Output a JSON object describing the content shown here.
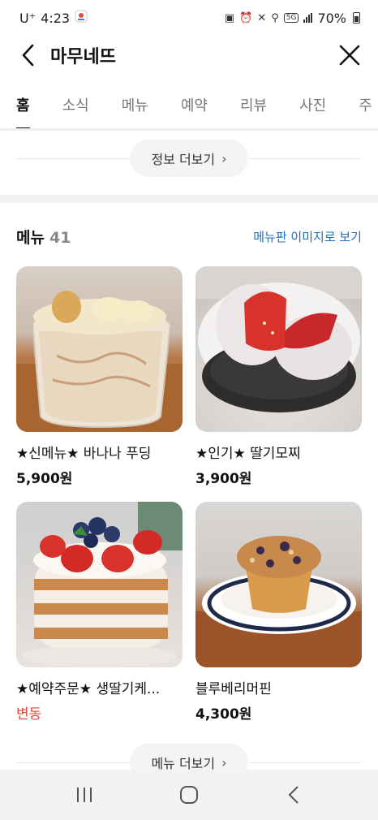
{
  "status_bar": {
    "carrier": "U⁺",
    "time": "4:23",
    "network": "5G",
    "battery_percent": "70%"
  },
  "header": {
    "title": "마무네뜨",
    "back_icon": "chevron-left-icon",
    "close_icon": "close-icon"
  },
  "tabs": [
    {
      "label": "홈",
      "active": true
    },
    {
      "label": "소식",
      "active": false
    },
    {
      "label": "메뉴",
      "active": false
    },
    {
      "label": "예약",
      "active": false
    },
    {
      "label": "리뷰",
      "active": false
    },
    {
      "label": "사진",
      "active": false
    },
    {
      "label": "주",
      "active": false
    }
  ],
  "info_more": {
    "label": "정보 더보기",
    "chevron": "›"
  },
  "menu_section": {
    "title": "메뉴",
    "count": "41",
    "image_link": "메뉴판 이미지로 보기"
  },
  "menu_items": [
    {
      "name": "★신메뉴★ 바나나 푸딩",
      "price": "5,900원",
      "variable": false
    },
    {
      "name": "★인기★ 딸기모찌",
      "price": "3,900원",
      "variable": false
    },
    {
      "name": "★예약주문★ 생딸기케...",
      "price": "변동",
      "variable": true
    },
    {
      "name": "블루베리머핀",
      "price": "4,300원",
      "variable": false
    }
  ],
  "menu_more": {
    "label": "메뉴 더보기",
    "chevron": "›"
  },
  "nav_bar": {
    "recent_icon": "recent-apps-icon",
    "home_icon": "home-icon",
    "back_icon": "back-icon"
  },
  "colors": {
    "link_blue": "#1f6fbf",
    "price_variable_red": "#e0443a"
  }
}
